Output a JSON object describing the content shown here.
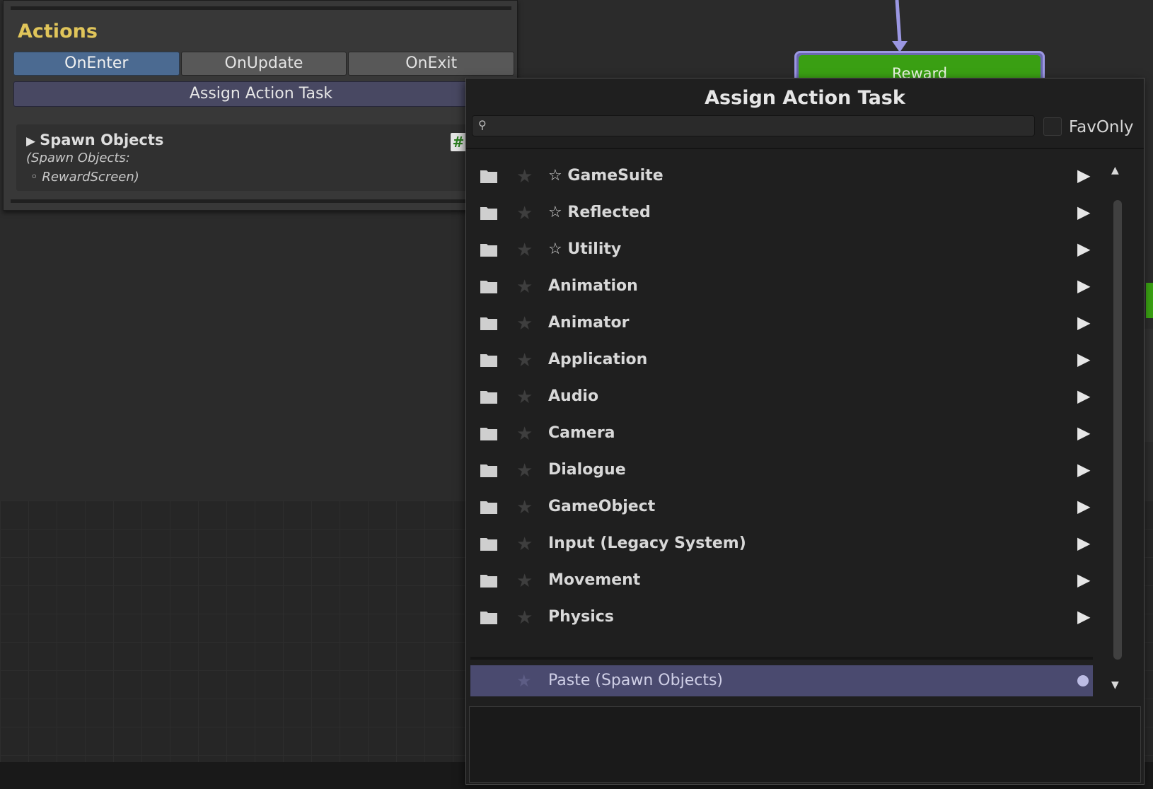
{
  "graph": {
    "reward_node": {
      "label": "Reward",
      "fill_color": "#3a9f13",
      "border_color": "#9b97e2"
    }
  },
  "inspector": {
    "title": "Actions",
    "tabs": [
      {
        "label": "OnEnter",
        "active": true
      },
      {
        "label": "OnUpdate",
        "active": false
      },
      {
        "label": "OnExit",
        "active": false
      }
    ],
    "assign_button": "Assign Action Task",
    "task": {
      "title": "Spawn Objects",
      "description_line1": "(Spawn Objects:",
      "description_line2": "◦ RewardScreen)",
      "badge": "#"
    }
  },
  "popup": {
    "title": "Assign Action Task",
    "search": {
      "value": "",
      "placeholder": ""
    },
    "fav_only": {
      "label": "FavOnly",
      "checked": false
    },
    "categories": [
      {
        "label": "☆ GameSuite"
      },
      {
        "label": "☆ Reflected"
      },
      {
        "label": "☆ Utility"
      },
      {
        "label": "Animation"
      },
      {
        "label": "Animator"
      },
      {
        "label": "Application"
      },
      {
        "label": "Audio"
      },
      {
        "label": "Camera"
      },
      {
        "label": "Dialogue"
      },
      {
        "label": "GameObject"
      },
      {
        "label": "Input (Legacy System)"
      },
      {
        "label": "Movement"
      },
      {
        "label": "Physics"
      }
    ],
    "paste_item": {
      "label": "Paste (Spawn Objects)"
    },
    "icons": {
      "folder": "folder-icon",
      "favorite": "star-icon",
      "submenu": "chevron-right-icon",
      "search": "search-icon"
    }
  }
}
